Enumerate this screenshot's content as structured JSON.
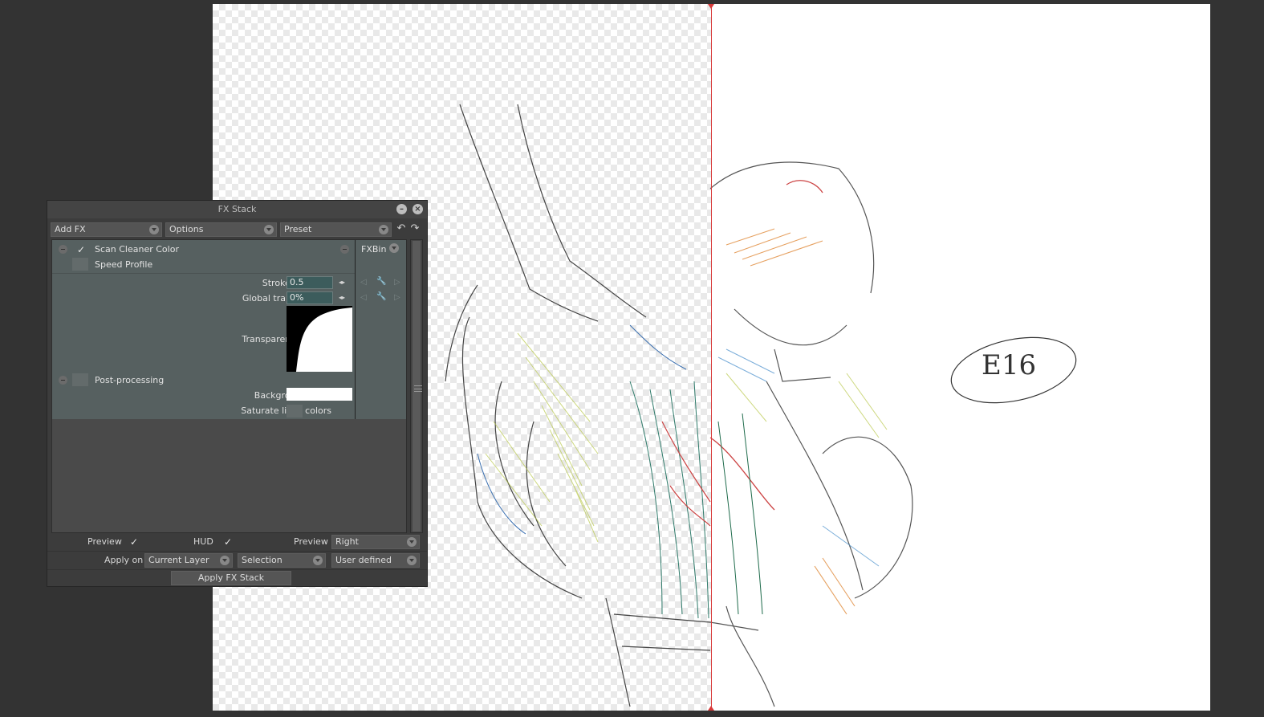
{
  "panel": {
    "title": "FX Stack",
    "add_fx": "Add FX",
    "options": "Options",
    "preset": "Preset"
  },
  "stack": {
    "fx_name": "Scan Cleaner Color",
    "speed_profile": "Speed Profile",
    "stroke_intensity_label": "Stroke intensity",
    "stroke_intensity_value": "0.5",
    "global_transparency_label": "Global transparency",
    "global_transparency_value": "0%",
    "transparency_profile_label": "Transparency profile",
    "post_processing": "Post-processing",
    "background_color_label": "Background color",
    "background_color": "#ffffff",
    "saturate_label": "Saturate lines colors",
    "fxbin": "FXBin"
  },
  "footer": {
    "preview_label": "Preview",
    "hud_label": "HUD",
    "preview_mode_label": "Preview",
    "preview_mode": "Right",
    "apply_on_label": "Apply on",
    "apply_on": "Current Layer",
    "selection": "Selection",
    "user_defined": "User defined",
    "apply_button": "Apply FX Stack"
  },
  "canvas": {
    "annotation": "E16"
  },
  "colors": {
    "split_line": "#d83a3a",
    "panel_bg": "#3c3c3c",
    "stack_bg": "#566060"
  }
}
